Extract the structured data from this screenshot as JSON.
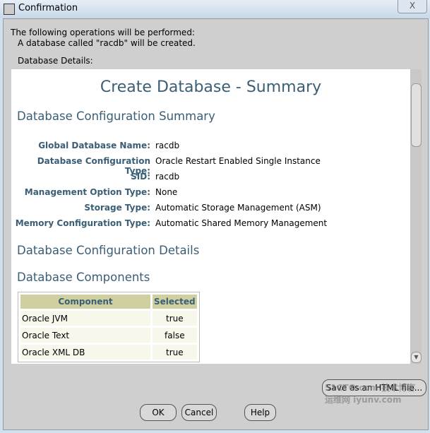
{
  "window": {
    "title": "Confirmation",
    "close": "X"
  },
  "message": {
    "line1": "The following operations will be performed:",
    "line2": "A database called \"racdb\" will be created.",
    "details_label": "Database Details:"
  },
  "summary": {
    "title": "Create Database - Summary",
    "section1": "Database Configuration Summary",
    "rows": [
      {
        "label": "Global Database Name:",
        "value": "racdb"
      },
      {
        "label": "Database Configuration Type:",
        "value": "Oracle Restart Enabled Single Instance"
      },
      {
        "label": "SID:",
        "value": "racdb"
      },
      {
        "label": "Management Option Type:",
        "value": "None"
      },
      {
        "label": "Storage Type:",
        "value": "Automatic Storage Management (ASM)"
      },
      {
        "label": "Memory Configuration Type:",
        "value": "Automatic Shared Memory Management"
      }
    ],
    "section2": "Database Configuration Details",
    "section3": "Database Components",
    "table": {
      "headers": [
        "Component",
        "Selected"
      ],
      "rows": [
        [
          "Oracle JVM",
          "true"
        ],
        [
          "Oracle Text",
          "false"
        ],
        [
          "Oracle XML DB",
          "true"
        ]
      ]
    }
  },
  "buttons": {
    "save": "Save as an HTML file...",
    "ok": "OK",
    "cancel": "Cancel",
    "help": "Help"
  },
  "watermark": "51CTO.com 技术博客 运维网 iyunv.com"
}
